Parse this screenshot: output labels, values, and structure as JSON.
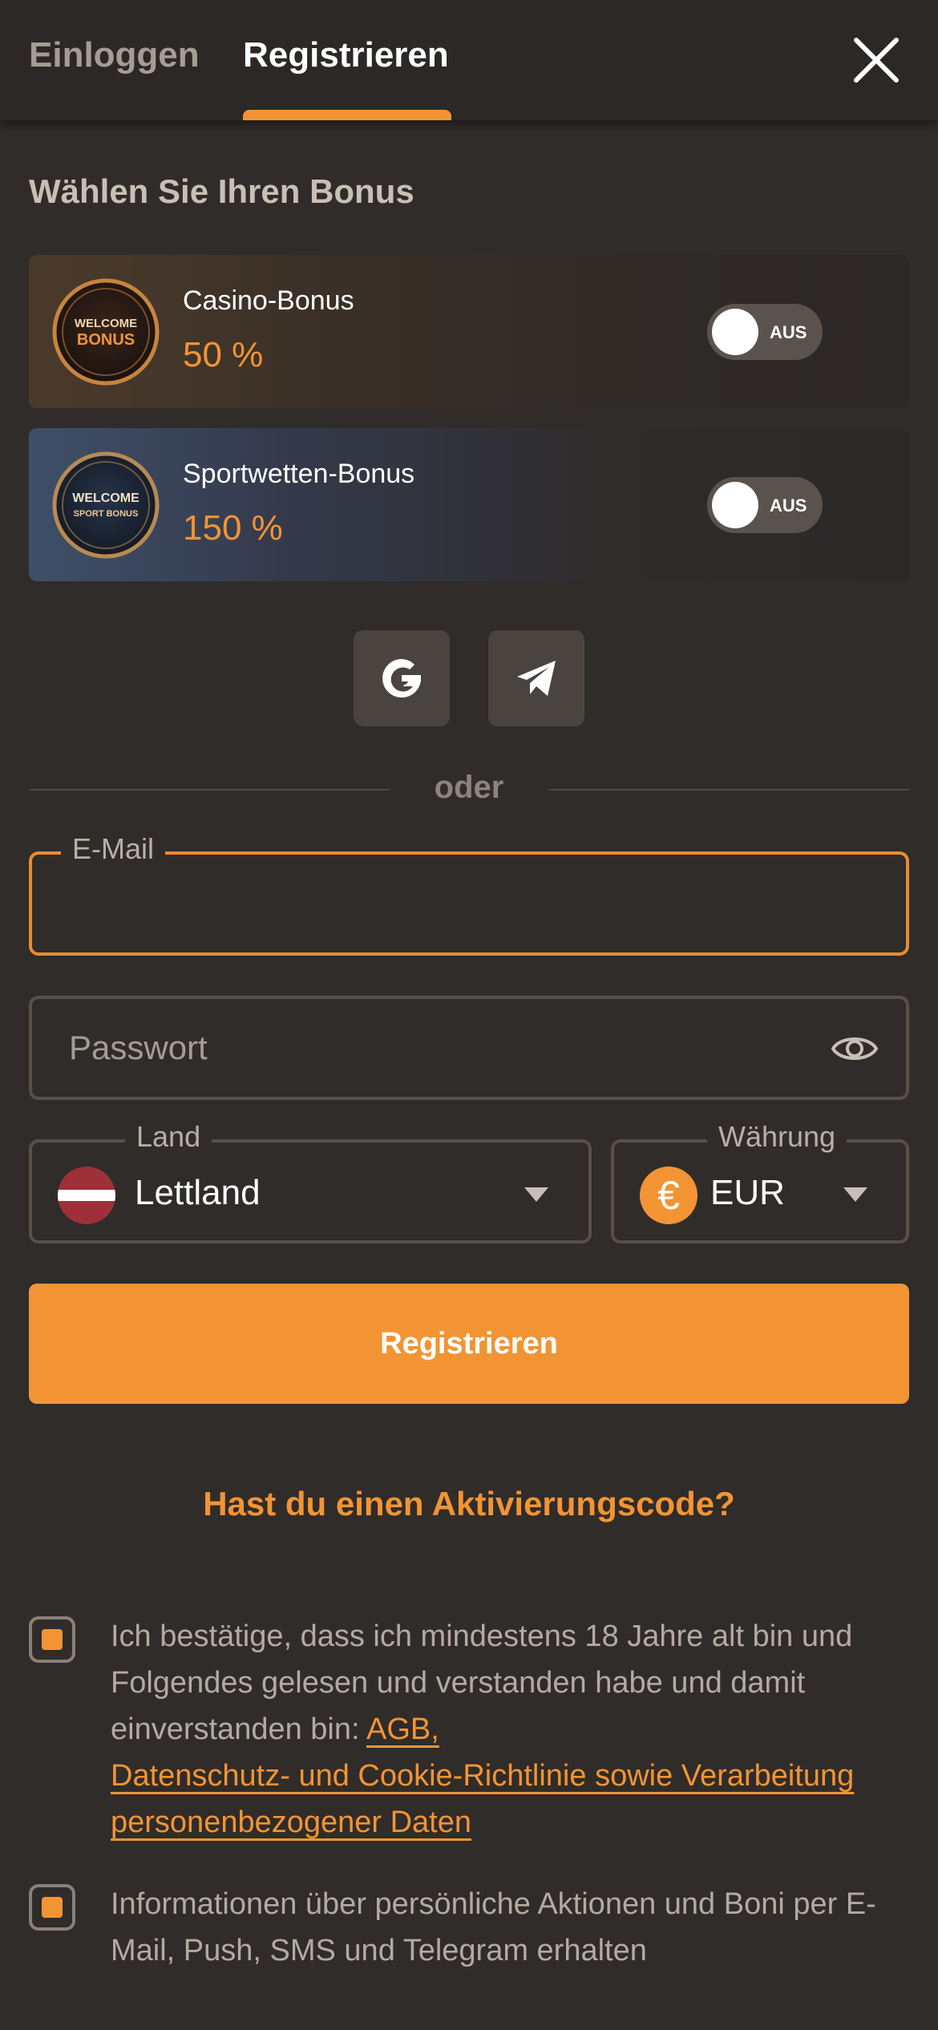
{
  "tabs": {
    "login": "Einloggen",
    "register": "Registrieren"
  },
  "section_title": "Wählen Sie Ihren Bonus",
  "bonuses": [
    {
      "name": "Casino-Bonus",
      "value": "50 %",
      "toggle": "AUS",
      "badge_line1": "WELCOME",
      "badge_line2": "BONUS"
    },
    {
      "name": "Sportwetten-Bonus",
      "value": "150 %",
      "toggle": "AUS",
      "badge_line1": "WELCOME",
      "badge_line2": "SPORT BONUS"
    }
  ],
  "divider": "oder",
  "fields": {
    "email_label": "E-Mail",
    "email_value": "",
    "password_placeholder": "Passwort",
    "country_label": "Land",
    "country_value": "Lettland",
    "currency_label": "Währung",
    "currency_value": "EUR",
    "currency_symbol": "€"
  },
  "register_button": "Registrieren",
  "activation_link": "Hast du einen Aktivierungscode?",
  "terms": {
    "text": "Ich bestätige, dass ich mindestens 18 Jahre alt bin und Folgendes gelesen und verstanden habe und damit einverstanden bin: ",
    "link_agb": "AGB,",
    "link_privacy": "Datenschutz- und Cookie-Richtlinie sowie Verarbeitung personenbezogener Daten"
  },
  "promo_consent": "Informationen über persönliche Aktionen und Boni per E-Mail, Push, SMS und Telegram erhalten",
  "colors": {
    "accent": "#f29434",
    "background": "#302c2a",
    "header": "#2c2826"
  },
  "icons": [
    "close-icon",
    "google-icon",
    "telegram-icon",
    "eye-icon",
    "latvia-flag-icon",
    "euro-icon",
    "chevron-down-icon"
  ]
}
